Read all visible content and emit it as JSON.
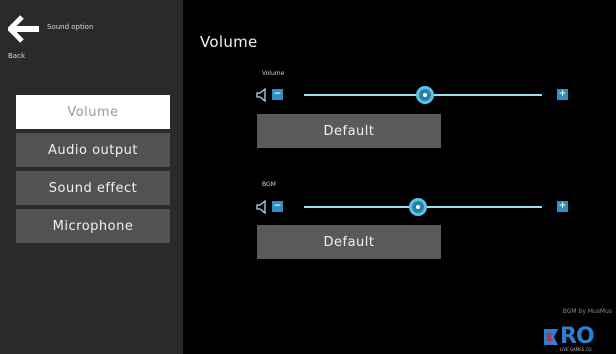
{
  "header": {
    "screen_title": "Sound option",
    "back_label": "Back"
  },
  "menu": {
    "items": [
      {
        "label": "Volume",
        "selected": true
      },
      {
        "label": "Audio output",
        "selected": false
      },
      {
        "label": "Sound effect",
        "selected": false
      },
      {
        "label": "Microphone",
        "selected": false
      }
    ]
  },
  "main": {
    "title": "Volume",
    "volume": {
      "label": "Volume",
      "level": 0.51,
      "minus_icon": "−",
      "plus_icon": "+",
      "default_label": "Default"
    },
    "bgm": {
      "label": "BGM",
      "level": 0.48,
      "minus_icon": "−",
      "plus_icon": "+",
      "default_label": "Default"
    }
  },
  "footer": {
    "credit": "BGM by MusMus",
    "logo_text": "RO",
    "logo_sub": "LIVE GAMES CO."
  },
  "colors": {
    "accent": "#2f8fc2",
    "slider_track": "#9fdcf0",
    "sidebar_bg": "#2a2a2a",
    "menu_item_bg": "#525252",
    "selected_bg": "#ffffff"
  }
}
